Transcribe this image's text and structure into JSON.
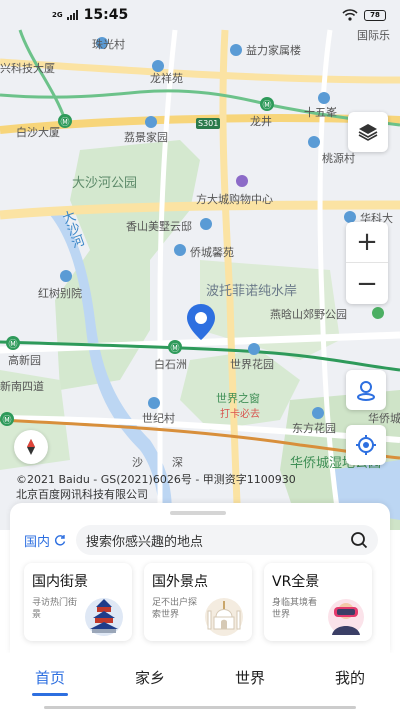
{
  "status_bar": {
    "network": "2G",
    "time": "15:45",
    "battery": "78"
  },
  "map": {
    "labels": {
      "zhuguangcun": "珠光村",
      "yilujiashu": "益力家属楼",
      "guojingle": "国际乐",
      "xingkejidasha": "兴科技大厦",
      "longxiangyuan": "龙祥苑",
      "shiwufeng": "十五峯",
      "longjing": "龙井",
      "baishadasha": "白沙大厦",
      "liejingjiayuan": "荔景家园",
      "taoyuancun": "桃源村",
      "dashahe_park": "大沙河公园",
      "fangdacheng": "方大城购物中心",
      "xiangshan": "香山美墅云邸",
      "huaqiaoxinyuan": "侨城馨苑",
      "huake": "华科大",
      "dashahe": "大沙河",
      "hongjiebieyuan": "红树别院",
      "potuofeinuo": "波托菲诺纯水岸",
      "yanhanshan": "燕晗山郊野公园",
      "gaoxinyuan": "高新园",
      "baishizhou": "白石洲",
      "shijiehuayuan": "世界花园",
      "xinnan": "新南四道",
      "shijiezhichuang": "世界之窗",
      "daka": "打卡必去",
      "shijicun": "世纪村",
      "dongfanghuayuan": "东方花园",
      "huaqiaocheng": "华侨城",
      "sha": "沙",
      "shen": "深",
      "huaqiaocheng_park": "华侨城湿地公园",
      "road_tag": "S301"
    },
    "copyright_line1": "©2021 Baidu - GS(2021)6026号 - 甲测资字1100930",
    "copyright_line2": "北京百度网讯科技有限公司",
    "zoom_in": "+",
    "zoom_out": "−"
  },
  "panel": {
    "region": "国内",
    "search_placeholder": "搜索你感兴趣的地点",
    "cards": [
      {
        "title": "国内街景",
        "subtitle": "寻访热门街景"
      },
      {
        "title": "国外景点",
        "subtitle": "足不出户探索世界"
      },
      {
        "title": "VR全景",
        "subtitle": "身临其境看世界"
      }
    ]
  },
  "tabs": [
    "首页",
    "家乡",
    "世界",
    "我的"
  ],
  "colors": {
    "accent": "#2d6fe0",
    "park": "#cfe6c9",
    "road": "#f7d57a",
    "metro": "#2e9a5a"
  }
}
